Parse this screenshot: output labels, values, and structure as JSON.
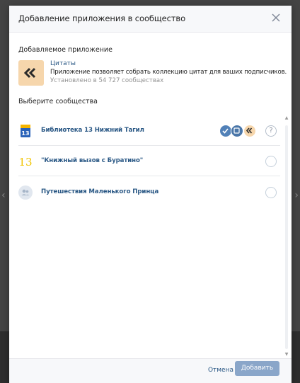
{
  "dialog": {
    "title": "Добавление приложения в сообщество"
  },
  "app_section": {
    "label": "Добавляемое приложение",
    "app": {
      "name": "Цитаты",
      "description": "Приложение позволяет собрать коллекцию цитат для ваших подписчиков.",
      "installs": "Установлено в 54 727 сообществах",
      "icon_color": "#f6d6ac",
      "icon": "double-chevron-left-icon"
    }
  },
  "communities_section": {
    "label": "Выберите сообщества",
    "items": [
      {
        "name": "Библиотека 13 Нижний Тагил",
        "avatar_text": "13",
        "control": "help",
        "help_label": "?"
      },
      {
        "name": "\"Книжный вызов с Буратино\"",
        "avatar_text": "13",
        "control": "radio"
      },
      {
        "name": "Путешествия Маленького Принца",
        "avatar_text": "",
        "control": "radio"
      }
    ]
  },
  "footer": {
    "cancel_label": "Отмена",
    "add_label": "Добавить"
  },
  "colors": {
    "link": "#2a5885",
    "primary_button_disabled": "#8aa6c9",
    "header_bg": "#f7f8fa"
  }
}
